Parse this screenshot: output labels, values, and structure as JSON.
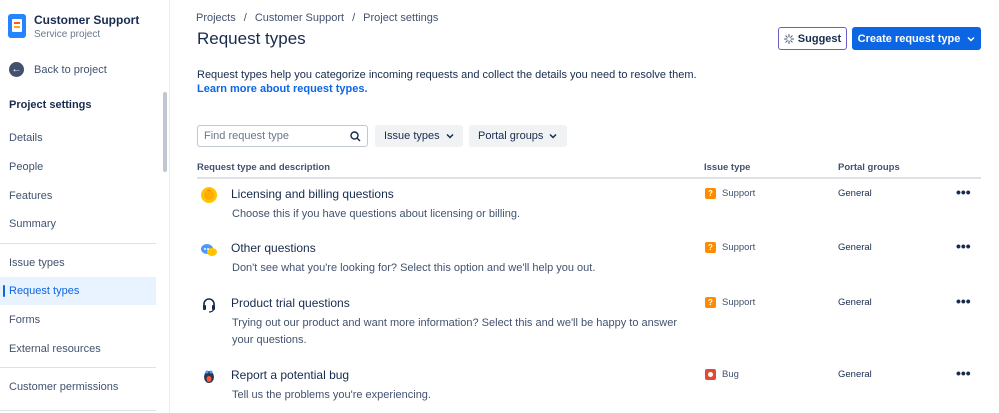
{
  "sidebar": {
    "project_name": "Customer Support",
    "project_type": "Service project",
    "back_label": "Back to project",
    "section_title": "Project settings",
    "items": [
      {
        "label": "Details"
      },
      {
        "label": "People"
      },
      {
        "label": "Features"
      },
      {
        "label": "Summary"
      },
      {
        "label": "Issue types"
      },
      {
        "label": "Request types",
        "active": true
      },
      {
        "label": "Forms"
      },
      {
        "label": "External resources"
      },
      {
        "label": "Customer permissions"
      }
    ]
  },
  "breadcrumb": [
    "Projects",
    "Customer Support",
    "Project settings"
  ],
  "page_title": "Request types",
  "buttons": {
    "suggest": "Suggest",
    "create": "Create request type"
  },
  "intro": {
    "text": "Request types help you categorize incoming requests and collect the details you need to resolve them.",
    "link": "Learn more about request types."
  },
  "search": {
    "placeholder": "Find request type"
  },
  "filters": {
    "issue_types": "Issue types",
    "portal_groups": "Portal groups"
  },
  "table": {
    "headers": [
      "Request type and description",
      "Issue type",
      "Portal groups"
    ],
    "rows": [
      {
        "title": "Licensing and billing questions",
        "desc": "Choose this if you have questions about licensing or billing.",
        "issue_type": "Support",
        "portal": "General",
        "icon": "coin-icon"
      },
      {
        "title": "Other questions",
        "desc": "Don't see what you're looking for? Select this option and we'll help you out.",
        "issue_type": "Support",
        "portal": "General",
        "icon": "chat-icon"
      },
      {
        "title": "Product trial questions",
        "desc": "Trying out our product and want more information? Select this and we'll be happy to answer your questions.",
        "issue_type": "Support",
        "portal": "General",
        "icon": "headset-icon"
      },
      {
        "title": "Report a potential bug",
        "desc": "Tell us the problems you're experiencing.",
        "issue_type": "Bug",
        "portal": "General",
        "icon": "bug-icon"
      }
    ]
  },
  "colors": {
    "accent": "#0c66e4",
    "support": "#ff8b00",
    "bug": "#e34935",
    "suggest_border": "#6e5dc6"
  }
}
